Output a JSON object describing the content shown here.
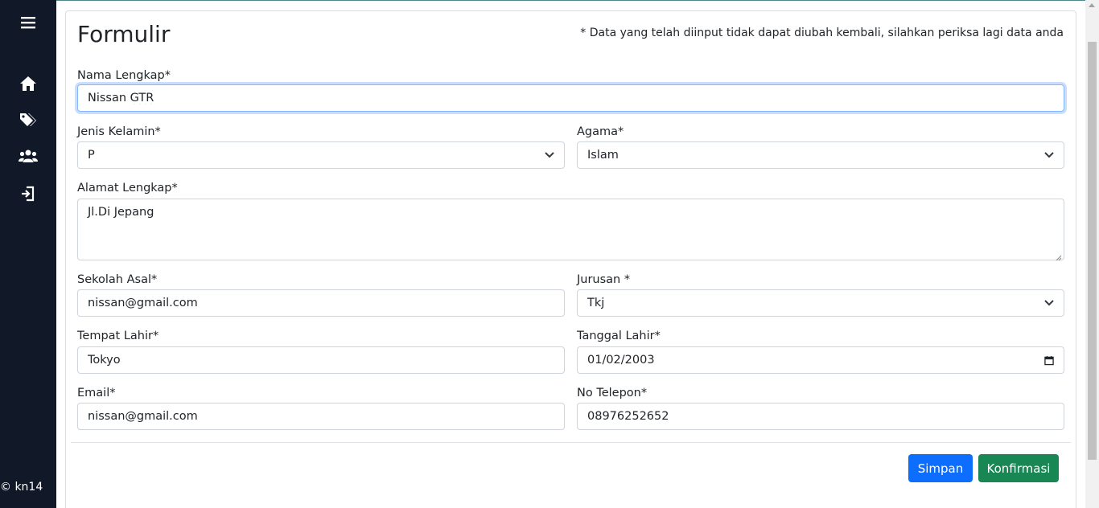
{
  "sidebar": {
    "icons": [
      "menu-icon",
      "home-icon",
      "tags-icon",
      "users-icon",
      "logout-icon"
    ],
    "footer": "© kn14"
  },
  "form": {
    "title": "Formulir",
    "notice": "* Data yang telah diinput tidak dapat diubah kembali, silahkan periksa lagi data anda",
    "nama": {
      "label": "Nama Lengkap*",
      "value_word1": "Nissan",
      "value_word2": "GTR"
    },
    "jenis_kelamin": {
      "label": "Jenis Kelamin*",
      "value": "P"
    },
    "agama": {
      "label": "Agama*",
      "value": "Islam"
    },
    "alamat": {
      "label": "Alamat Lengkap*",
      "value": "Jl.Di Jepang"
    },
    "sekolah": {
      "label": "Sekolah Asal*",
      "value": "nissan@gmail.com"
    },
    "jurusan": {
      "label": "Jurusan *",
      "value": "Tkj"
    },
    "tempat_lahir": {
      "label": "Tempat Lahir*",
      "value": "Tokyo"
    },
    "tanggal_lahir": {
      "label": "Tanggal Lahir*",
      "value": "01/02/2003"
    },
    "email": {
      "label": "Email*",
      "value": "nissan@gmail.com"
    },
    "telepon": {
      "label": "No Telepon*",
      "value": "08976252652"
    }
  },
  "buttons": {
    "simpan": "Simpan",
    "konfirmasi": "Konfirmasi"
  },
  "colors": {
    "sidebar": "#111827",
    "primary": "#0d6efd",
    "success": "#198754"
  }
}
